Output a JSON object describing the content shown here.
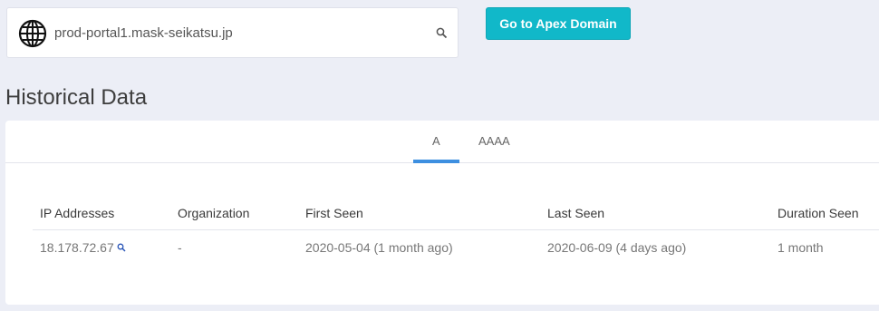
{
  "search": {
    "value": "prod-portal1.mask-seikatsu.jp",
    "globe_icon": "globe-icon",
    "search_icon": "search-icon"
  },
  "apex_button": {
    "label": "Go to Apex Domain",
    "color": "#11b8c9"
  },
  "section": {
    "title": "Historical Data"
  },
  "tabs": [
    {
      "label": "A",
      "active": true
    },
    {
      "label": "AAAA",
      "active": false
    }
  ],
  "table": {
    "columns": [
      "IP Addresses",
      "Organization",
      "First Seen",
      "Last Seen",
      "Duration Seen"
    ],
    "rows": [
      {
        "ip": "18.178.72.67",
        "organization": "-",
        "first_seen": "2020-05-04 (1 month ago)",
        "last_seen": "2020-06-09 (4 days ago)",
        "duration": "1 month"
      }
    ]
  },
  "colors": {
    "accent": "#3d8fe0",
    "background": "#eceef6"
  }
}
